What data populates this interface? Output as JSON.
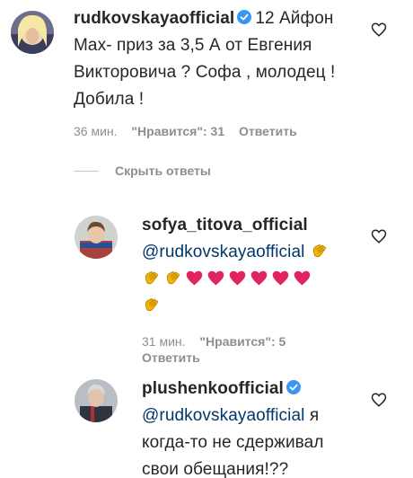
{
  "comments": [
    {
      "username": "rudkovskayaofficial",
      "verified": true,
      "text_lines": [
        "12 Айфон",
        "Max- приз за 3,5 А от Евгения",
        "Викторовича ? Софа , молодец !",
        "Добила !"
      ],
      "time": "36 мин.",
      "likes": "\"Нравится\": 31",
      "reply": "Ответить"
    }
  ],
  "hide_replies": "Скрыть ответы",
  "replies": [
    {
      "username": "sofya_titova_official",
      "verified": false,
      "mention": "@rudkovskayaofficial",
      "emoji_line1": [
        "clap"
      ],
      "emoji_line2": [
        "clap",
        "clap",
        "heart",
        "heart",
        "heart",
        "heart",
        "heart",
        "heart"
      ],
      "emoji_line3": [
        "clap"
      ],
      "time": "31 мин.",
      "likes": "\"Нравится\": 5",
      "reply": "Ответить"
    },
    {
      "username": "plushenkoofficial",
      "verified": true,
      "mention": "@rudkovskayaofficial",
      "text_after_mention": "я",
      "text_lines": [
        "когда-то не сдерживал",
        "свои обещания!??"
      ]
    }
  ],
  "colors": {
    "verified": "#3897f0",
    "mention": "#00376b",
    "meta": "#8e8e8e",
    "heart_emoji": "#e0245e",
    "clap_emoji": "#f4b400"
  }
}
